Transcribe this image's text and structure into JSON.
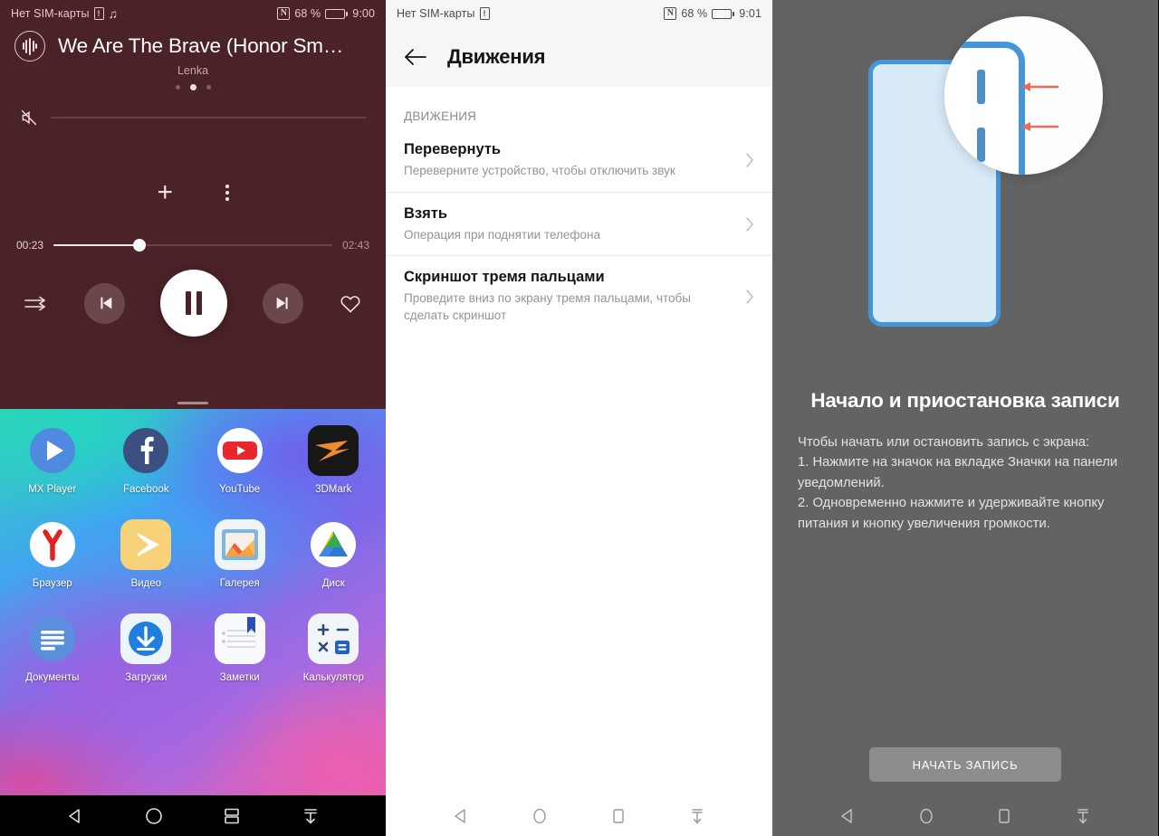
{
  "panel_player": {
    "status": {
      "carrier": "Нет SIM-карты",
      "sim_icon": "sim-card-alert-icon",
      "music_icon": "music-note-icon",
      "nfc_icon": "nfc-icon",
      "battery_pct": "68 %",
      "battery_level": 62,
      "time": "9:00"
    },
    "album_icon": "audio-waveform-icon",
    "track_title": "We Are The Brave (Honor Sm…",
    "artist": "Lenka",
    "page_dots": 3,
    "page_active": 1,
    "volume_icon": "volume-mute-icon",
    "add_icon": "plus-icon",
    "more_icon": "kebab-menu-icon",
    "time_current": "00:23",
    "time_total": "02:43",
    "progress_pct": 31,
    "shuffle_icon": "shuffle-icon",
    "prev_icon": "skip-previous-icon",
    "play_icon": "pause-icon",
    "next_icon": "skip-next-icon",
    "favorite_icon": "heart-outline-icon",
    "accent_bg": "#4a2227"
  },
  "panel_home": {
    "apps": [
      {
        "label": "MX Player",
        "icon": "mx-player-icon"
      },
      {
        "label": "Facebook",
        "icon": "facebook-icon"
      },
      {
        "label": "YouTube",
        "icon": "youtube-icon"
      },
      {
        "label": "3DMark",
        "icon": "3dmark-icon"
      },
      {
        "label": "Браузер",
        "icon": "yandex-browser-icon"
      },
      {
        "label": "Видео",
        "icon": "video-player-icon"
      },
      {
        "label": "Галерея",
        "icon": "gallery-icon"
      },
      {
        "label": "Диск",
        "icon": "google-drive-icon"
      },
      {
        "label": "Документы",
        "icon": "google-docs-icon"
      },
      {
        "label": "Загрузки",
        "icon": "downloads-icon"
      },
      {
        "label": "Заметки",
        "icon": "notes-icon"
      },
      {
        "label": "Калькулятор",
        "icon": "calculator-icon"
      }
    ]
  },
  "panel_settings": {
    "status": {
      "carrier": "Нет SIM-карты",
      "sim_icon": "sim-card-alert-icon",
      "nfc_icon": "nfc-icon",
      "battery_pct": "68 %",
      "battery_level": 62,
      "time": "9:01"
    },
    "back_icon": "back-arrow-icon",
    "title": "Движения",
    "section_label": "ДВИЖЕНИЯ",
    "items": [
      {
        "title": "Перевернуть",
        "subtitle": "Переверните устройство, чтобы отключить звук",
        "chevron": "chevron-right-icon"
      },
      {
        "title": "Взять",
        "subtitle": "Операция при поднятии телефона",
        "chevron": "chevron-right-icon"
      },
      {
        "title": "Скриншот тремя пальцами",
        "subtitle": "Проведите вниз по экрану тремя пальцами, чтобы сделать скриншот",
        "chevron": "chevron-right-icon"
      }
    ]
  },
  "panel_tip": {
    "illustration": "phone-side-buttons-magnifier-illustration",
    "title": "Начало и приостановка записи",
    "body": "Чтобы начать или остановить запись с экрана:\n1. Нажмите на значок на вкладке Значки на панели уведомлений.\n2. Одновременно нажмите и удерживайте кнопку питания и кнопку увеличения громкости.",
    "button_label": "НАЧАТЬ ЗАПИСЬ",
    "accent_blue": "#4596d8",
    "arrow_red": "#ef6a55",
    "overlay_bg": "#636363"
  },
  "navbar": {
    "back_icon": "nav-back-icon",
    "home_icon": "nav-home-icon",
    "recents_icon": "nav-recents-icon",
    "notification_icon": "nav-pull-down-icon"
  }
}
